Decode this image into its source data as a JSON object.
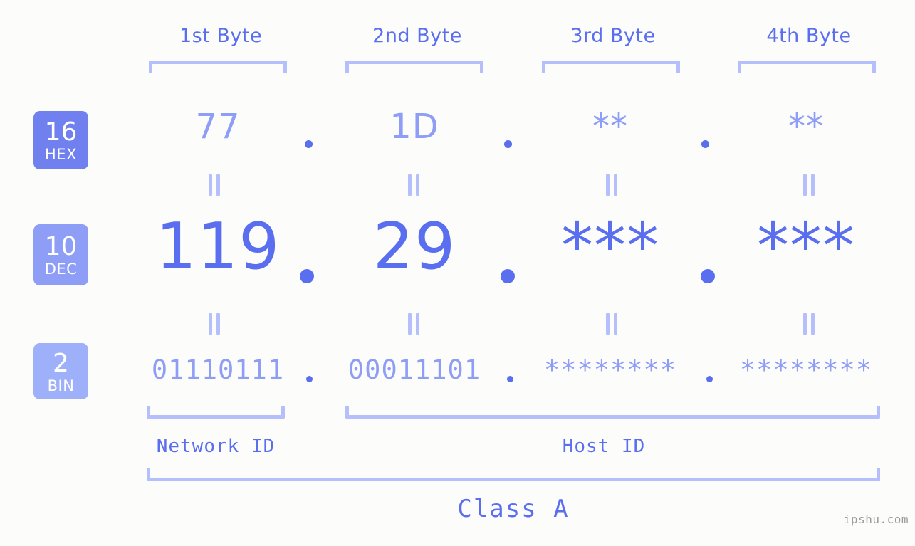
{
  "watermark": "ipshu.com",
  "background_color": "#fcfdfa",
  "accent_colors": {
    "strong": "#5a6ef0",
    "medium": "#8e9df6",
    "light": "#b5bffb"
  },
  "byte_headers": [
    {
      "label": "1st Byte"
    },
    {
      "label": "2nd Byte"
    },
    {
      "label": "3rd Byte"
    },
    {
      "label": "4th Byte"
    }
  ],
  "radix_badges": [
    {
      "number": "16",
      "name": "HEX",
      "color": "#7081ef"
    },
    {
      "number": "10",
      "name": "DEC",
      "color": "#8e9df6"
    },
    {
      "number": "2",
      "name": "BIN",
      "color": "#9db0f9"
    }
  ],
  "rows": {
    "hex": {
      "values": [
        "77",
        "1D",
        "**",
        "**"
      ],
      "separator": "."
    },
    "dec": {
      "values": [
        "119",
        "29",
        "***",
        "***"
      ],
      "separator": "."
    },
    "bin": {
      "values": [
        "01110111",
        "00011101",
        "********",
        "********"
      ],
      "separator": "."
    }
  },
  "equals_glyph": "=",
  "segments": {
    "network_id": "Network ID",
    "host_id": "Host ID",
    "class": "Class A"
  }
}
